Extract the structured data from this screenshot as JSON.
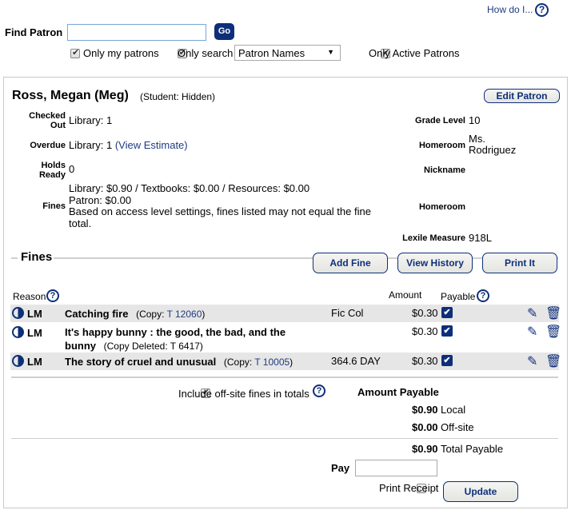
{
  "header": {
    "how_do_i": "How do I...",
    "help_glyph": "?"
  },
  "search": {
    "label": "Find Patron",
    "input_value": "",
    "go_label": "Go",
    "only_my_patrons": {
      "label": "Only my patrons",
      "checked": true
    },
    "only_search": {
      "label": "Only search",
      "checked": true
    },
    "search_type_selected": "Patron Names",
    "only_active": {
      "label": "Only Active Patrons",
      "checked": true
    }
  },
  "patron": {
    "name": "Ross, Megan (Meg)",
    "status": "(Student: Hidden)",
    "edit_label": "Edit Patron",
    "left_fields": [
      {
        "label": "Checked Out",
        "value": "Library: 1"
      },
      {
        "label": "Overdue",
        "value": "Library: 1",
        "link": "(View Estimate)"
      },
      {
        "label": "Holds Ready",
        "value": "0"
      },
      {
        "label": "Fines",
        "lines": [
          "Library: $0.90 / Textbooks: $0.00 / Resources: $0.00",
          "Patron: $0.00",
          "Based on access level settings, fines listed may not equal the fine total."
        ]
      }
    ],
    "right_fields": [
      {
        "label": "Grade Level",
        "value": "10"
      },
      {
        "label": "Homeroom",
        "value": "Ms. Rodriguez"
      },
      {
        "label": "Nickname",
        "value": ""
      },
      {
        "label": "Homeroom",
        "value": ""
      },
      {
        "label": "Lexile Measure",
        "value": "918L"
      }
    ]
  },
  "fines": {
    "title": "Fines",
    "buttons": {
      "add": "Add Fine",
      "history": "View History",
      "print": "Print It"
    },
    "columns": {
      "reason": "Reason",
      "amount": "Amount",
      "payable": "Payable"
    },
    "rows": [
      {
        "type": "LM",
        "title": "Catching fire",
        "copy_prefix": "(Copy: ",
        "copy_id": "T 12060",
        "copy_suffix": ")",
        "note": "Fic Col",
        "amount": "$0.30",
        "payable": true
      },
      {
        "type": "LM",
        "title": "It's happy bunny : the good, the bad, and the bunny",
        "copy_prefix": "(Copy Deleted: T 6417)",
        "copy_id": "",
        "copy_suffix": "",
        "note": "",
        "amount": "$0.30",
        "payable": true
      },
      {
        "type": "LM",
        "title": "The story of cruel and unusual",
        "copy_prefix": "(Copy: ",
        "copy_id": "T 10005",
        "copy_suffix": ")",
        "note": "364.6 DAY",
        "amount": "$0.30",
        "payable": true
      }
    ],
    "include_offsite": {
      "label": "Include off-site fines in totals",
      "checked": true
    },
    "amount_payable_title": "Amount Payable",
    "local": {
      "amount": "$0.90",
      "label": "Local"
    },
    "offsite": {
      "amount": "$0.00",
      "label": "Off-site"
    },
    "total": {
      "amount": "$0.90",
      "label": "Total Payable"
    },
    "pay_label": "Pay",
    "pay_value": "",
    "print_receipt": {
      "label": "Print Receipt",
      "checked": false
    },
    "update_label": "Update"
  }
}
